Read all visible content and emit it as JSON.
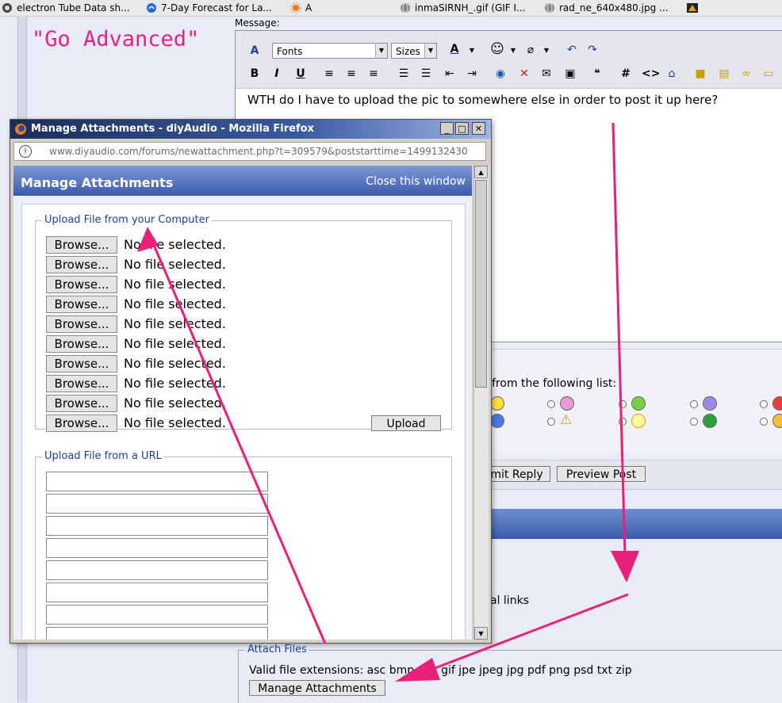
{
  "bookmarks": [
    {
      "label": "electron Tube Data sh...",
      "icon": "tube-site-icon"
    },
    {
      "label": "7-Day Forecast for La...",
      "icon": "weather-icon"
    },
    {
      "label": "A",
      "icon": "sun-icon"
    },
    {
      "label": "inmaSIRNH_.gif (GIF I...",
      "icon": "globe-icon"
    },
    {
      "label": "rad_ne_640x480.jpg ...",
      "icon": "globe-icon"
    }
  ],
  "annotation": {
    "go_advanced": "\"Go Advanced\""
  },
  "editor": {
    "label": "Message:",
    "font_select": "Fonts",
    "size_select": "Sizes",
    "text": "WTH do I have to upload the pic to somewhere else in order to post it up here?"
  },
  "background_page": {
    "smilie_label": "from the following list:",
    "submit_reply": "mit Reply",
    "preview_post": "Preview Post",
    "links_text": "al links",
    "attach_legend": "Attach Files",
    "valid_extensions": "Valid file extensions: asc bmp doc gif jpe jpeg jpg pdf png psd txt zip",
    "manage_attachments": "Manage Attachments"
  },
  "popup": {
    "window_title": "Manage Attachments - diyAudio - Mozilla Firefox",
    "url": "www.diyaudio.com/forums/newattachment.php?t=309579&poststarttime=1499132430",
    "header_title": "Manage Attachments",
    "close_link": "Close this window",
    "upload_computer_legend": "Upload File from your Computer",
    "browse_label": "Browse...",
    "no_file_label": "No file selected.",
    "upload_button": "Upload",
    "upload_url_legend": "Upload File from a URL"
  },
  "colors": {
    "arrow": "#e8207a",
    "title_bar": "#1a2e5a",
    "header_blue": "#3b5cae"
  }
}
